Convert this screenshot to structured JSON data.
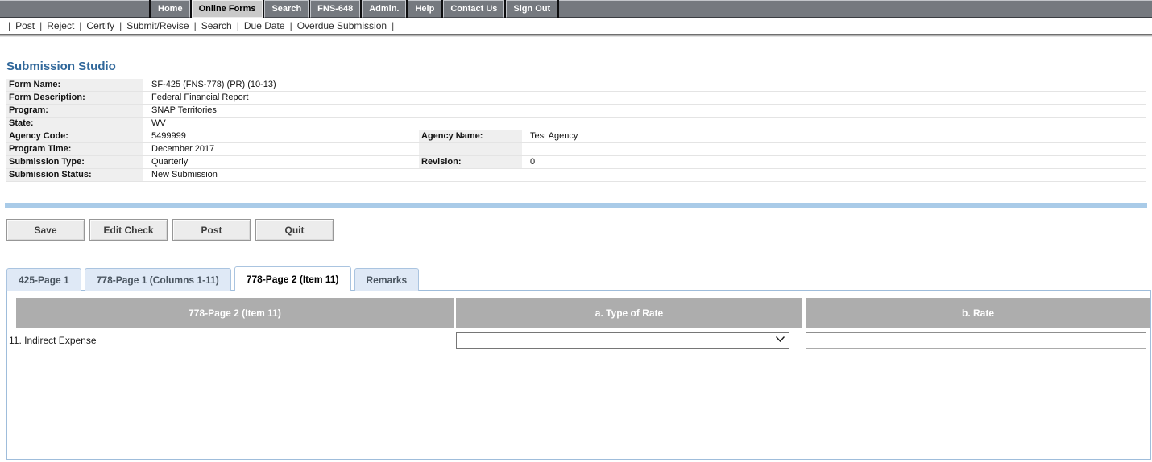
{
  "top_nav": {
    "items": [
      {
        "label": "Home",
        "active": false
      },
      {
        "label": "Online Forms",
        "active": true
      },
      {
        "label": "Search",
        "active": false
      },
      {
        "label": "FNS-648",
        "active": false
      },
      {
        "label": "Admin.",
        "active": false
      },
      {
        "label": "Help",
        "active": false
      },
      {
        "label": "Contact Us",
        "active": false
      },
      {
        "label": "Sign Out",
        "active": false
      }
    ]
  },
  "action_menu": {
    "separator": "|",
    "items": [
      "Post",
      "Reject",
      "Certify",
      "Submit/Revise",
      "Search",
      "Due Date",
      "Overdue Submission"
    ]
  },
  "page": {
    "title": "Submission Studio"
  },
  "details": {
    "rows": [
      {
        "label": "Form Name:",
        "value": "SF-425 (FNS-778) (PR) (10-13)"
      },
      {
        "label": "Form Description:",
        "value": "Federal Financial Report"
      },
      {
        "label": "Program:",
        "value": "SNAP Territories"
      },
      {
        "label": "State:",
        "value": "WV"
      },
      {
        "label": "Agency Code:",
        "value": "5499999",
        "label2": "Agency Name:",
        "value2": "Test Agency"
      },
      {
        "label": "Program Time:",
        "value": "December 2017",
        "label2": "",
        "value2": ""
      },
      {
        "label": "Submission Type:",
        "value": "Quarterly",
        "label2": "Revision:",
        "value2": "0"
      },
      {
        "label": "Submission Status:",
        "value": "New Submission"
      }
    ]
  },
  "toolbar": {
    "buttons": [
      "Save",
      "Edit Check",
      "Post",
      "Quit"
    ]
  },
  "tabs": [
    {
      "label": "425-Page 1",
      "active": false
    },
    {
      "label": "778-Page 1 (Columns 1-11)",
      "active": false
    },
    {
      "label": "778-Page 2 (Item 11)",
      "active": true
    },
    {
      "label": "Remarks",
      "active": false
    }
  ],
  "form_table": {
    "headers": [
      "778-Page 2 (Item 11)",
      "a. Type of Rate",
      "b. Rate"
    ],
    "rows": [
      {
        "label": "11. Indirect Expense",
        "type_of_rate": {
          "value": ""
        },
        "rate": {
          "value": ""
        }
      }
    ]
  },
  "colors": {
    "title_blue": "#31689b",
    "divider_blue": "#a9cbe8",
    "tab_inactive_bg": "#dfe9f6",
    "tab_border": "#aac4e0",
    "table_header_gray": "#adadad",
    "nav_gray": "#75797F",
    "nav_active_gray": "#c9c9c9",
    "label_cell_gray": "#efefef"
  }
}
